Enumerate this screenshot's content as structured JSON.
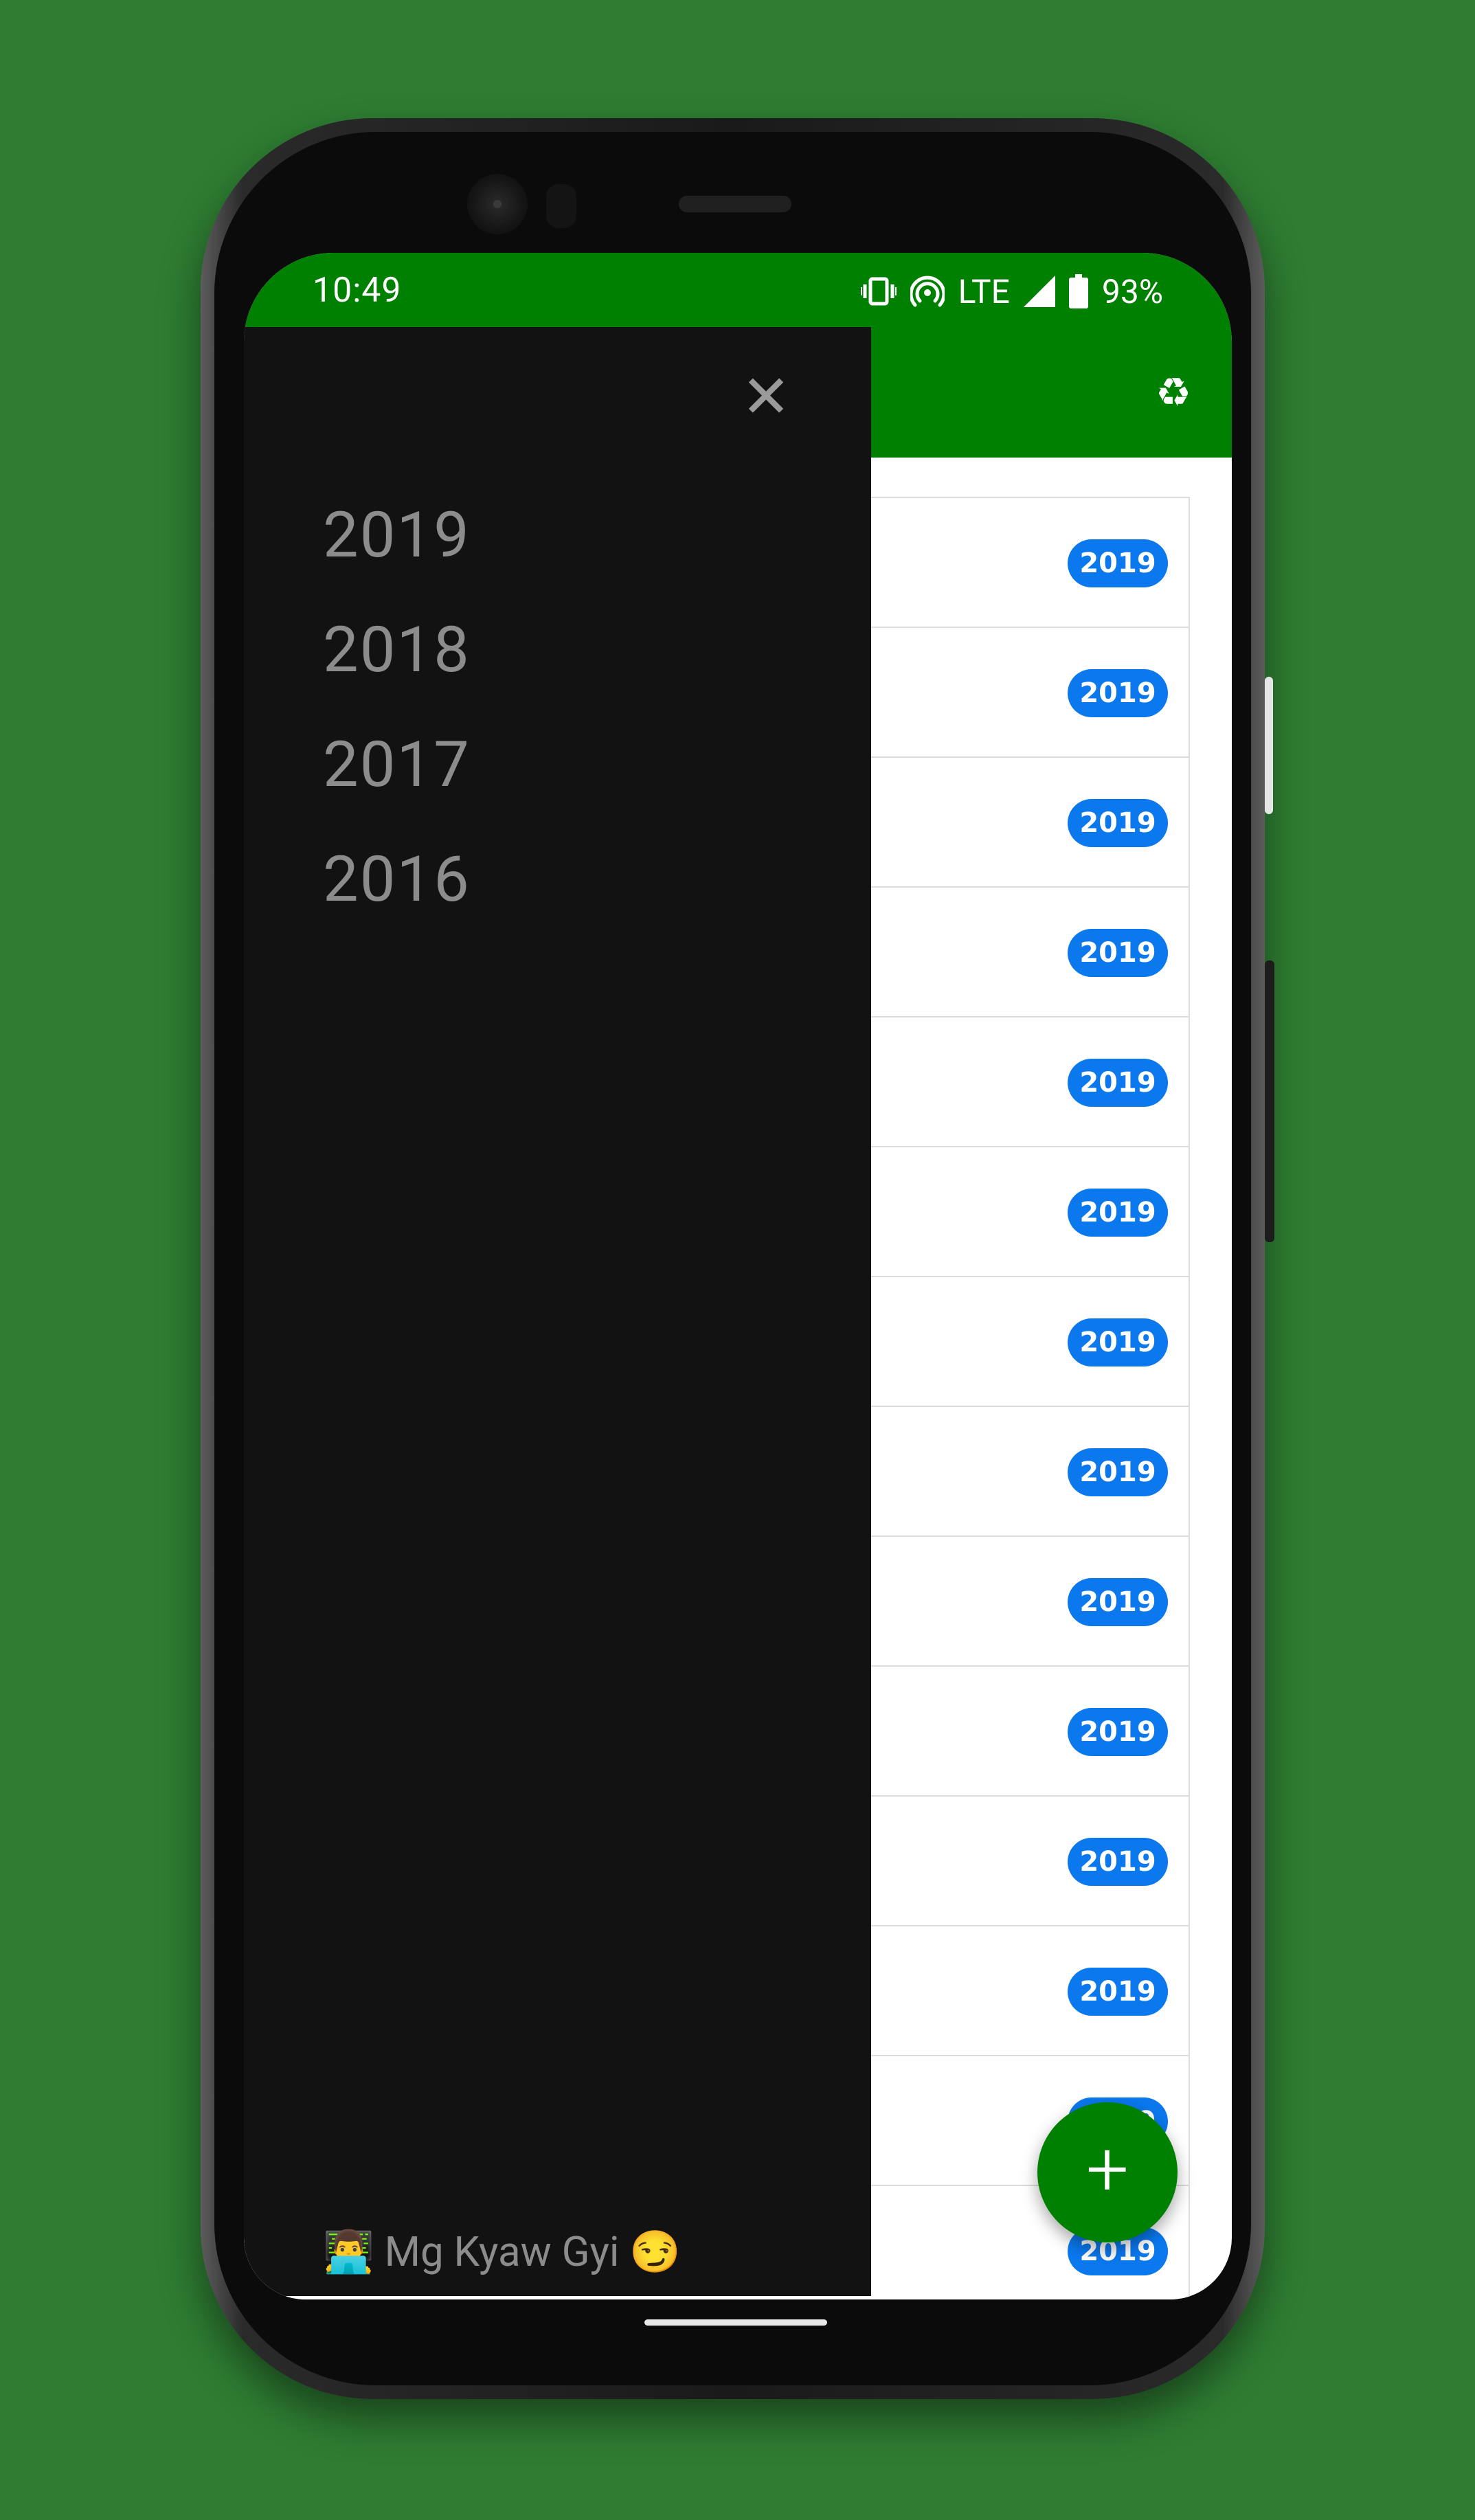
{
  "status_bar": {
    "time": "10:49",
    "network": "LTE",
    "battery": "93%"
  },
  "app_bar": {
    "recycle_icon": "recycle-icon",
    "background": "#008000"
  },
  "list": {
    "items": [
      {
        "badge": "2019"
      },
      {
        "badge": "2019"
      },
      {
        "badge": "2019"
      },
      {
        "badge": "2019"
      },
      {
        "badge": "2019"
      },
      {
        "badge": "2019"
      },
      {
        "badge": "2019"
      },
      {
        "badge": "2019"
      },
      {
        "badge": "2019"
      },
      {
        "badge": "2019"
      },
      {
        "badge": "2019"
      },
      {
        "badge": "2019"
      },
      {
        "badge": "2019"
      },
      {
        "badge": "2019"
      }
    ],
    "badge_color": "#0b78ee"
  },
  "drawer": {
    "close_icon": "close-icon",
    "years": [
      "2019",
      "2018",
      "2017",
      "2016"
    ],
    "footer": "👨‍💻 Mg Kyaw Gyi 😏",
    "background": "#121212"
  },
  "fab": {
    "label": "+"
  }
}
